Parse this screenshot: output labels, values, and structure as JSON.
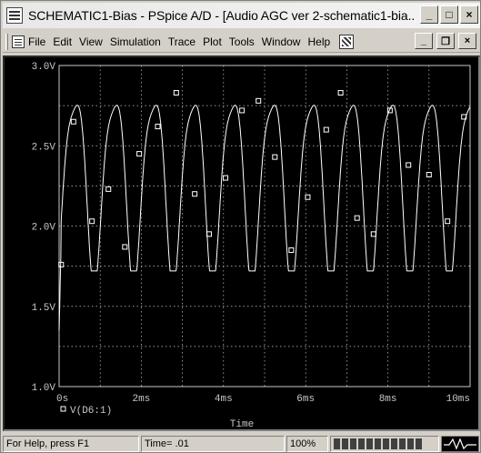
{
  "window": {
    "title": "SCHEMATIC1-Bias - PSpice A/D  - [Audio AGC ver 2-schematic1-bia...",
    "app_icon": "pspice-app-icon",
    "controls": {
      "minimize": "_",
      "maximize": "□",
      "close": "×"
    }
  },
  "menu": {
    "items": [
      {
        "label": "File"
      },
      {
        "label": "Edit"
      },
      {
        "label": "View"
      },
      {
        "label": "Simulation"
      },
      {
        "label": "Trace"
      },
      {
        "label": "Plot"
      },
      {
        "label": "Tools"
      },
      {
        "label": "Window"
      },
      {
        "label": "Help"
      }
    ],
    "mdi_controls": {
      "minimize": "_",
      "restore": "❐",
      "close": "×"
    }
  },
  "chart_data": {
    "type": "line",
    "xlabel": "Time",
    "ylabel": "",
    "xlim": [
      0,
      10
    ],
    "ylim": [
      1.0,
      3.0
    ],
    "x_ticks": [
      "0s",
      "2ms",
      "4ms",
      "6ms",
      "8ms",
      "10ms"
    ],
    "y_ticks": [
      "1.0V",
      "1.5V",
      "2.0V",
      "2.5V",
      "3.0V"
    ],
    "grid": true,
    "legend_position": "bottom-left",
    "series": [
      {
        "name": "V(D6:1)",
        "marker": "square",
        "period_ms": 0.96,
        "waveform": {
          "start_ms": 0,
          "end_ms": 10,
          "peak_v": 2.85,
          "trough_v": 1.72,
          "baseline_v": 1.9,
          "initial_v": 1.35
        },
        "markers": [
          [
            0.05,
            1.76
          ],
          [
            0.35,
            2.65
          ],
          [
            0.8,
            2.03
          ],
          [
            1.2,
            2.23
          ],
          [
            1.6,
            1.87
          ],
          [
            1.95,
            2.45
          ],
          [
            2.4,
            2.62
          ],
          [
            2.85,
            2.83
          ],
          [
            3.3,
            2.2
          ],
          [
            3.65,
            1.95
          ],
          [
            4.05,
            2.3
          ],
          [
            4.45,
            2.72
          ],
          [
            4.85,
            2.78
          ],
          [
            5.25,
            2.43
          ],
          [
            5.65,
            1.85
          ],
          [
            6.05,
            2.18
          ],
          [
            6.5,
            2.6
          ],
          [
            6.85,
            2.83
          ],
          [
            7.25,
            2.05
          ],
          [
            7.65,
            1.95
          ],
          [
            8.05,
            2.72
          ],
          [
            8.5,
            2.38
          ],
          [
            9.0,
            2.32
          ],
          [
            9.45,
            2.03
          ],
          [
            9.85,
            2.68
          ]
        ]
      }
    ]
  },
  "status": {
    "help_text": "For Help, press F1",
    "time_text": "Time= .01",
    "zoom": "100%",
    "progress_segments": 11
  },
  "colors": {
    "plot_bg": "#000000",
    "grid": "#c8c8c8",
    "trace": "#ffffff",
    "chrome": "#d4d0c8"
  }
}
